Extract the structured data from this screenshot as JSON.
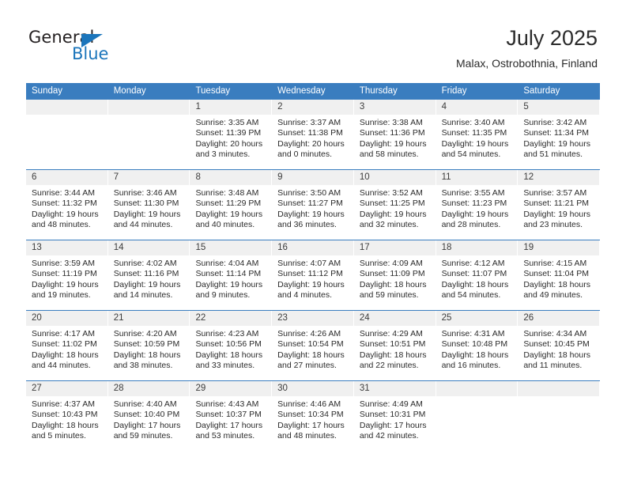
{
  "brand": {
    "name_part1": "General",
    "name_part2": "Blue",
    "primary_color": "#1b75bb"
  },
  "header": {
    "title": "July 2025",
    "subtitle": "Malax, Ostrobothnia, Finland"
  },
  "calendar": {
    "header_bg": "#3a7dbf",
    "day_band_bg": "#f0f0f0",
    "weekdays": [
      "Sunday",
      "Monday",
      "Tuesday",
      "Wednesday",
      "Thursday",
      "Friday",
      "Saturday"
    ],
    "weeks": [
      [
        {
          "day": "",
          "lines": []
        },
        {
          "day": "",
          "lines": []
        },
        {
          "day": "1",
          "lines": [
            "Sunrise: 3:35 AM",
            "Sunset: 11:39 PM",
            "Daylight: 20 hours",
            "and 3 minutes."
          ]
        },
        {
          "day": "2",
          "lines": [
            "Sunrise: 3:37 AM",
            "Sunset: 11:38 PM",
            "Daylight: 20 hours",
            "and 0 minutes."
          ]
        },
        {
          "day": "3",
          "lines": [
            "Sunrise: 3:38 AM",
            "Sunset: 11:36 PM",
            "Daylight: 19 hours",
            "and 58 minutes."
          ]
        },
        {
          "day": "4",
          "lines": [
            "Sunrise: 3:40 AM",
            "Sunset: 11:35 PM",
            "Daylight: 19 hours",
            "and 54 minutes."
          ]
        },
        {
          "day": "5",
          "lines": [
            "Sunrise: 3:42 AM",
            "Sunset: 11:34 PM",
            "Daylight: 19 hours",
            "and 51 minutes."
          ]
        }
      ],
      [
        {
          "day": "6",
          "lines": [
            "Sunrise: 3:44 AM",
            "Sunset: 11:32 PM",
            "Daylight: 19 hours",
            "and 48 minutes."
          ]
        },
        {
          "day": "7",
          "lines": [
            "Sunrise: 3:46 AM",
            "Sunset: 11:30 PM",
            "Daylight: 19 hours",
            "and 44 minutes."
          ]
        },
        {
          "day": "8",
          "lines": [
            "Sunrise: 3:48 AM",
            "Sunset: 11:29 PM",
            "Daylight: 19 hours",
            "and 40 minutes."
          ]
        },
        {
          "day": "9",
          "lines": [
            "Sunrise: 3:50 AM",
            "Sunset: 11:27 PM",
            "Daylight: 19 hours",
            "and 36 minutes."
          ]
        },
        {
          "day": "10",
          "lines": [
            "Sunrise: 3:52 AM",
            "Sunset: 11:25 PM",
            "Daylight: 19 hours",
            "and 32 minutes."
          ]
        },
        {
          "day": "11",
          "lines": [
            "Sunrise: 3:55 AM",
            "Sunset: 11:23 PM",
            "Daylight: 19 hours",
            "and 28 minutes."
          ]
        },
        {
          "day": "12",
          "lines": [
            "Sunrise: 3:57 AM",
            "Sunset: 11:21 PM",
            "Daylight: 19 hours",
            "and 23 minutes."
          ]
        }
      ],
      [
        {
          "day": "13",
          "lines": [
            "Sunrise: 3:59 AM",
            "Sunset: 11:19 PM",
            "Daylight: 19 hours",
            "and 19 minutes."
          ]
        },
        {
          "day": "14",
          "lines": [
            "Sunrise: 4:02 AM",
            "Sunset: 11:16 PM",
            "Daylight: 19 hours",
            "and 14 minutes."
          ]
        },
        {
          "day": "15",
          "lines": [
            "Sunrise: 4:04 AM",
            "Sunset: 11:14 PM",
            "Daylight: 19 hours",
            "and 9 minutes."
          ]
        },
        {
          "day": "16",
          "lines": [
            "Sunrise: 4:07 AM",
            "Sunset: 11:12 PM",
            "Daylight: 19 hours",
            "and 4 minutes."
          ]
        },
        {
          "day": "17",
          "lines": [
            "Sunrise: 4:09 AM",
            "Sunset: 11:09 PM",
            "Daylight: 18 hours",
            "and 59 minutes."
          ]
        },
        {
          "day": "18",
          "lines": [
            "Sunrise: 4:12 AM",
            "Sunset: 11:07 PM",
            "Daylight: 18 hours",
            "and 54 minutes."
          ]
        },
        {
          "day": "19",
          "lines": [
            "Sunrise: 4:15 AM",
            "Sunset: 11:04 PM",
            "Daylight: 18 hours",
            "and 49 minutes."
          ]
        }
      ],
      [
        {
          "day": "20",
          "lines": [
            "Sunrise: 4:17 AM",
            "Sunset: 11:02 PM",
            "Daylight: 18 hours",
            "and 44 minutes."
          ]
        },
        {
          "day": "21",
          "lines": [
            "Sunrise: 4:20 AM",
            "Sunset: 10:59 PM",
            "Daylight: 18 hours",
            "and 38 minutes."
          ]
        },
        {
          "day": "22",
          "lines": [
            "Sunrise: 4:23 AM",
            "Sunset: 10:56 PM",
            "Daylight: 18 hours",
            "and 33 minutes."
          ]
        },
        {
          "day": "23",
          "lines": [
            "Sunrise: 4:26 AM",
            "Sunset: 10:54 PM",
            "Daylight: 18 hours",
            "and 27 minutes."
          ]
        },
        {
          "day": "24",
          "lines": [
            "Sunrise: 4:29 AM",
            "Sunset: 10:51 PM",
            "Daylight: 18 hours",
            "and 22 minutes."
          ]
        },
        {
          "day": "25",
          "lines": [
            "Sunrise: 4:31 AM",
            "Sunset: 10:48 PM",
            "Daylight: 18 hours",
            "and 16 minutes."
          ]
        },
        {
          "day": "26",
          "lines": [
            "Sunrise: 4:34 AM",
            "Sunset: 10:45 PM",
            "Daylight: 18 hours",
            "and 11 minutes."
          ]
        }
      ],
      [
        {
          "day": "27",
          "lines": [
            "Sunrise: 4:37 AM",
            "Sunset: 10:43 PM",
            "Daylight: 18 hours",
            "and 5 minutes."
          ]
        },
        {
          "day": "28",
          "lines": [
            "Sunrise: 4:40 AM",
            "Sunset: 10:40 PM",
            "Daylight: 17 hours",
            "and 59 minutes."
          ]
        },
        {
          "day": "29",
          "lines": [
            "Sunrise: 4:43 AM",
            "Sunset: 10:37 PM",
            "Daylight: 17 hours",
            "and 53 minutes."
          ]
        },
        {
          "day": "30",
          "lines": [
            "Sunrise: 4:46 AM",
            "Sunset: 10:34 PM",
            "Daylight: 17 hours",
            "and 48 minutes."
          ]
        },
        {
          "day": "31",
          "lines": [
            "Sunrise: 4:49 AM",
            "Sunset: 10:31 PM",
            "Daylight: 17 hours",
            "and 42 minutes."
          ]
        },
        {
          "day": "",
          "lines": []
        },
        {
          "day": "",
          "lines": []
        }
      ]
    ]
  }
}
